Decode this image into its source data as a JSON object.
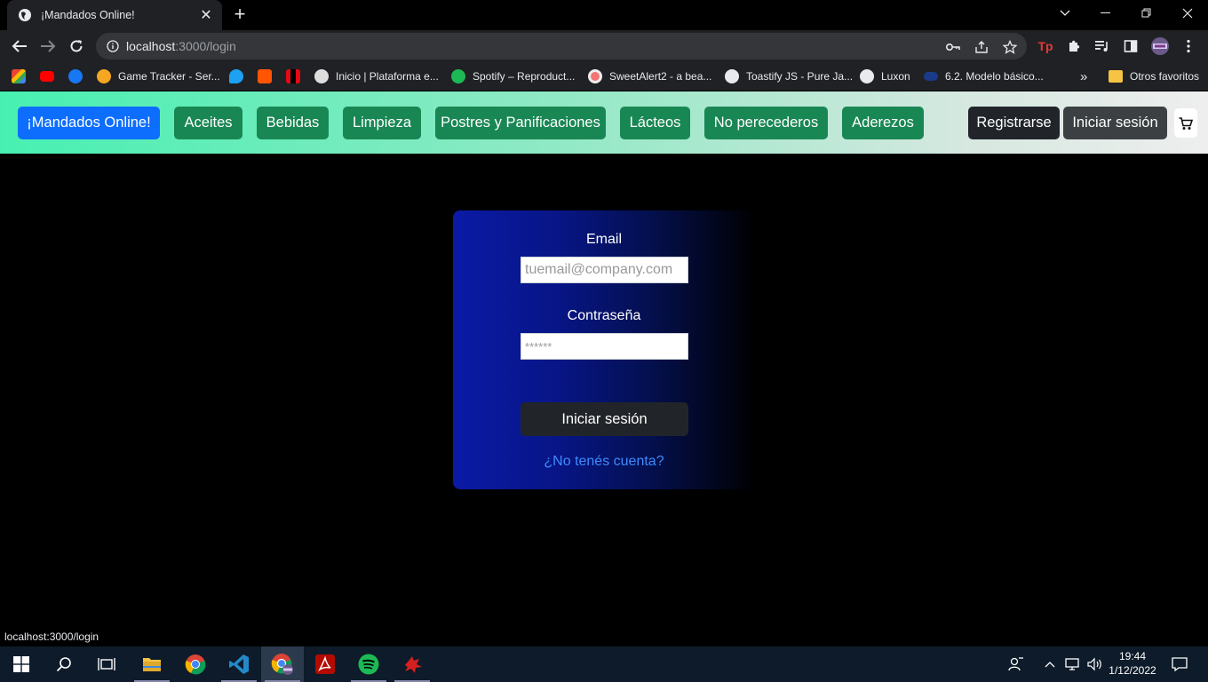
{
  "browser": {
    "tab_title": "¡Mandados Online!",
    "new_tab_symbol": "+",
    "url_host": "localhost",
    "url_rest": ":3000/login"
  },
  "bookmarks": [
    {
      "label": "",
      "icon": "gmail-icon",
      "color": "#ea4335"
    },
    {
      "label": "",
      "icon": "youtube-icon",
      "color": "#ff0000"
    },
    {
      "label": "",
      "icon": "facebook-icon",
      "color": "#1877f2"
    },
    {
      "label": "Game Tracker - Ser...",
      "icon": "gametracker-icon",
      "color": "#f5a623"
    },
    {
      "label": "",
      "icon": "twitter-icon",
      "color": "#1da1f2"
    },
    {
      "label": "",
      "icon": "soundcloud-icon",
      "color": "#ff5500"
    },
    {
      "label": "",
      "icon": "netflix-icon",
      "color": "#e50914"
    },
    {
      "label": "Inicio | Plataforma e...",
      "icon": "plataforma-icon",
      "color": "#dddddd"
    },
    {
      "label": "Spotify – Reproduct...",
      "icon": "spotify-icon",
      "color": "#1db954"
    },
    {
      "label": "SweetAlert2 - a bea...",
      "icon": "sweetalert-icon",
      "color": "#f27474"
    },
    {
      "label": "Toastify JS - Pure Ja...",
      "icon": "globe-icon",
      "color": "#e8eaed"
    },
    {
      "label": "Luxon",
      "icon": "globe-icon",
      "color": "#e8eaed"
    },
    {
      "label": "6.2. Modelo básico...",
      "icon": "modelo-icon",
      "color": "#1a3a8a"
    }
  ],
  "bookmarks_overflow": "»",
  "other_bookmarks": "Otros favoritos",
  "navbar": {
    "brand": "¡Mandados Online!",
    "categories": [
      "Aceites",
      "Bebidas",
      "Limpieza",
      "Postres y Panificaciones",
      "Lácteos",
      "No perecederos",
      "Aderezos"
    ],
    "register": "Registrarse",
    "login": "Iniciar sesión"
  },
  "login_form": {
    "email_label": "Email",
    "email_placeholder": "tuemail@company.com",
    "password_label": "Contraseña",
    "password_placeholder": "******",
    "submit": "Iniciar sesión",
    "register_link": "¿No tenés cuenta?"
  },
  "status_url": "localhost:3000/login",
  "taskbar": {
    "time": "19:44",
    "date": "1/12/2022"
  },
  "colors": {
    "navbar_green": "#198754",
    "brand_blue": "#0d6efd",
    "card_blue": "#0b1aa6",
    "link_blue": "#3d8bfd"
  }
}
